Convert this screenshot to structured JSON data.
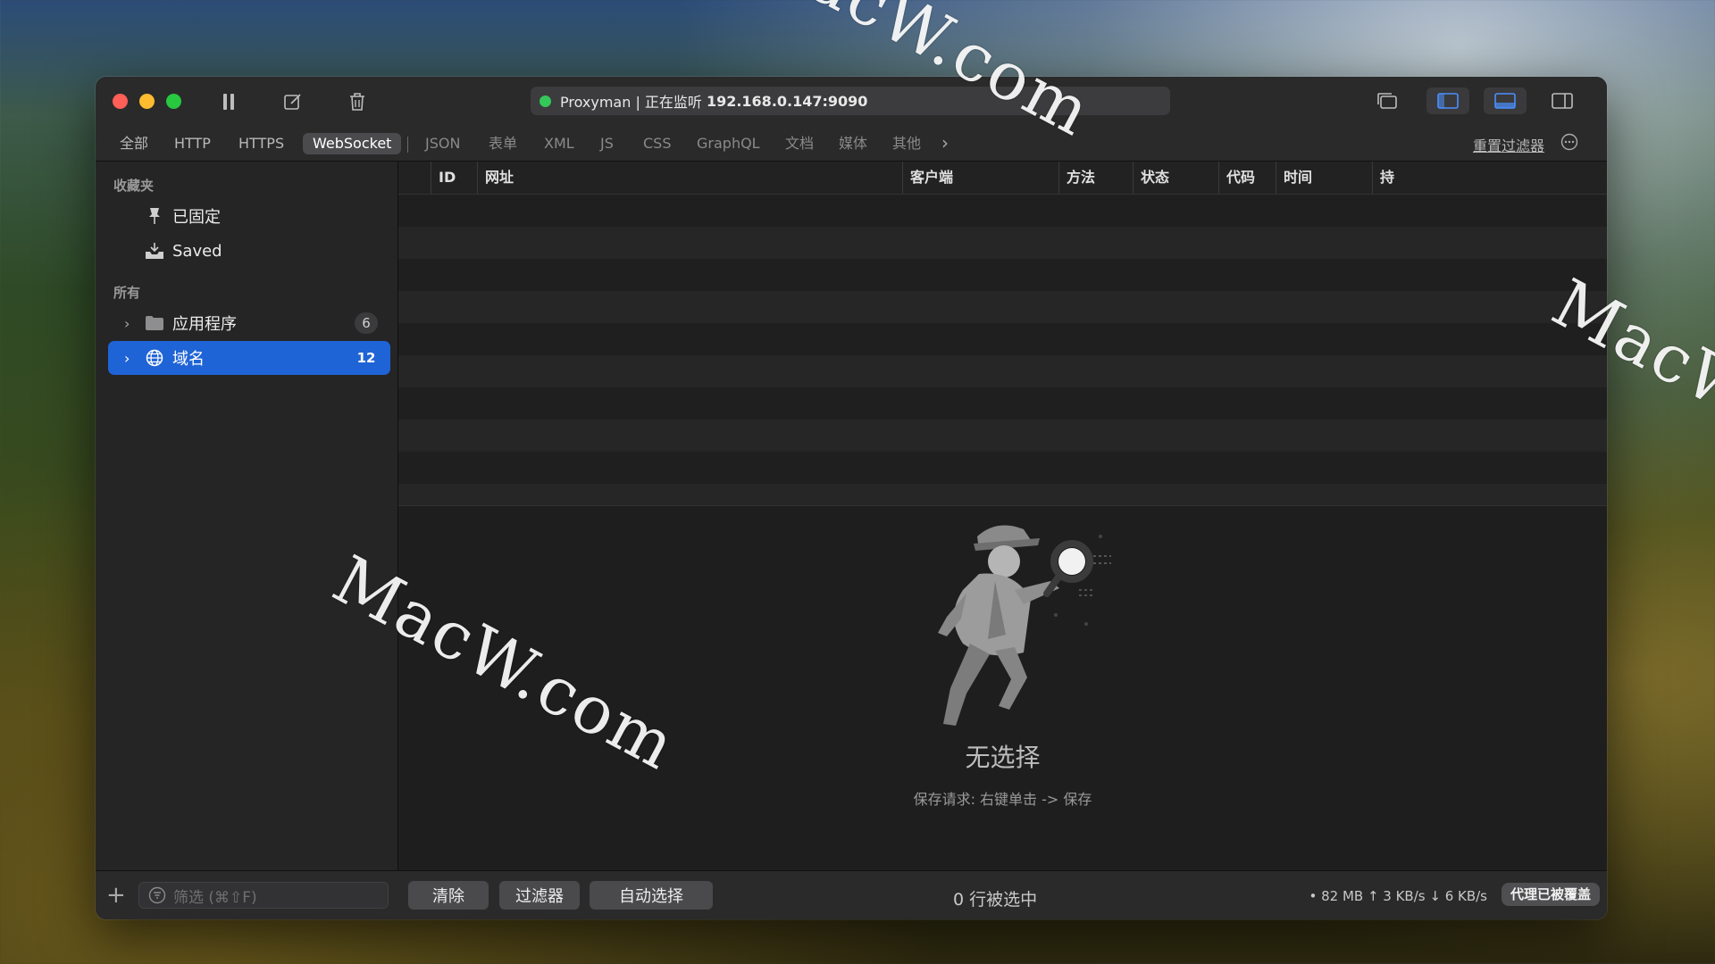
{
  "app": {
    "proxy_name": "Proxyman | 正在监听",
    "proxy_address": "192.168.0.147:9090",
    "status_color": "#34c759"
  },
  "filter_tabs": [
    {
      "label": "全部"
    },
    {
      "label": "HTTP"
    },
    {
      "label": "HTTPS"
    },
    {
      "label": "WebSocket",
      "selected": true
    },
    {
      "label": "JSON"
    },
    {
      "label": "表单"
    },
    {
      "label": "XML"
    },
    {
      "label": "JS"
    },
    {
      "label": "CSS"
    },
    {
      "label": "GraphQL"
    },
    {
      "label": "文档"
    },
    {
      "label": "媒体"
    },
    {
      "label": "其他"
    }
  ],
  "reset_filter_label": "重置过滤器",
  "sidebar": {
    "favorites_title": "收藏夹",
    "pinned_label": "已固定",
    "saved_label": "Saved",
    "all_title": "所有",
    "apps_label": "应用程序",
    "apps_count": "6",
    "domains_label": "域名",
    "domains_count": "12"
  },
  "table": {
    "columns": [
      "ID",
      "网址",
      "客户端",
      "方法",
      "状态",
      "代码",
      "时间",
      "持"
    ]
  },
  "empty_state": {
    "title": "无选择",
    "hint": "保存请求: 右键单击 -> 保存"
  },
  "bottom": {
    "filter_placeholder": "筛选 (⌘⇧F)",
    "clear_label": "清除",
    "filter_label": "过滤器",
    "auto_select_label": "自动选择",
    "selection_text": "0 行被选中",
    "stats_text": "• 82 MB ↑ 3 KB/s ↓ 6 KB/s",
    "override_label": "代理已被覆盖"
  },
  "watermark": "MacW.com",
  "accent_color": "#1f64d6"
}
